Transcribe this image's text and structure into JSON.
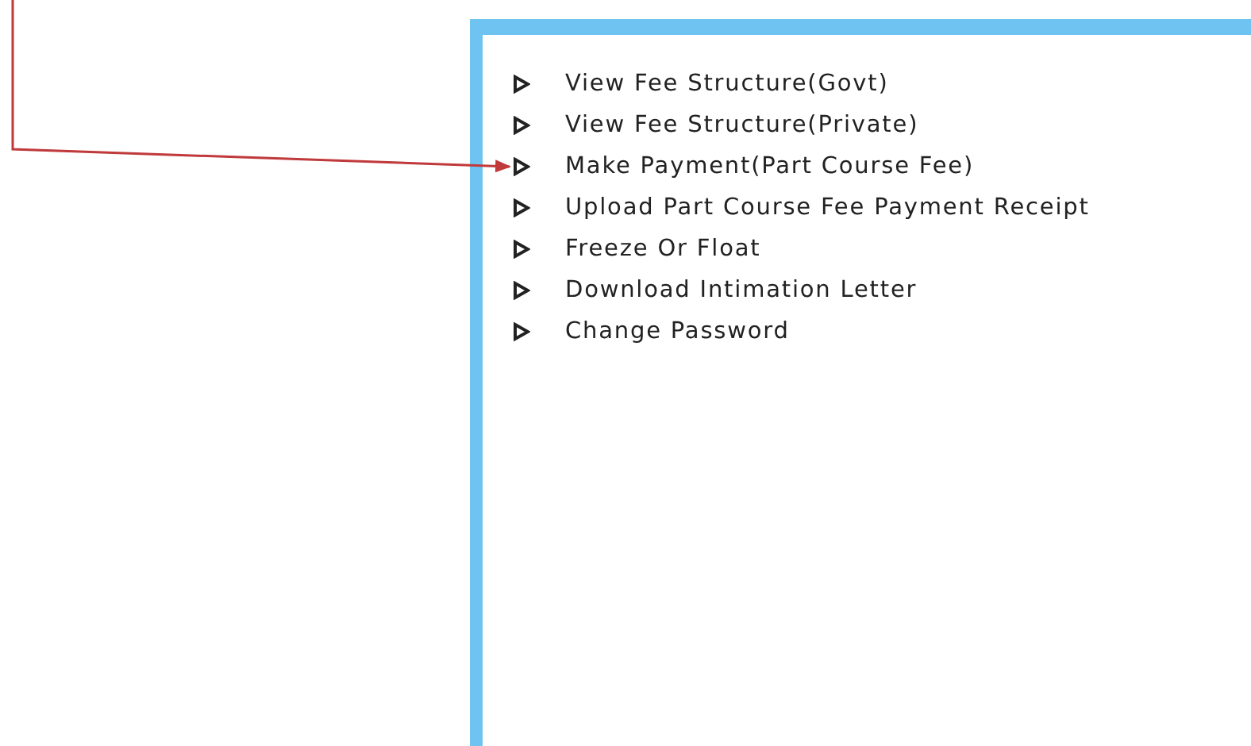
{
  "menu": {
    "items": [
      {
        "label": "View Fee Structure(Govt)",
        "pointed": false
      },
      {
        "label": "View Fee Structure(Private)",
        "pointed": false
      },
      {
        "label": "Make Payment(Part Course Fee)",
        "pointed": true
      },
      {
        "label": "Upload Part Course Fee Payment Receipt",
        "pointed": false
      },
      {
        "label": "Freeze Or Float",
        "pointed": false
      },
      {
        "label": "Download Intimation Letter",
        "pointed": false
      },
      {
        "label": "Change Password",
        "pointed": false
      }
    ]
  }
}
